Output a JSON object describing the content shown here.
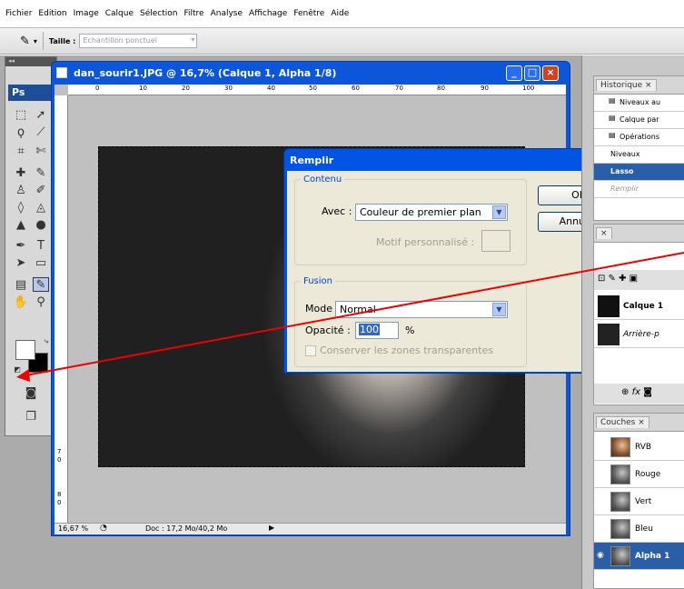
{
  "menu": [
    "Fichier",
    "Edition",
    "Image",
    "Calque",
    "Sélection",
    "Filtre",
    "Analyse",
    "Affichage",
    "Fenêtre",
    "Aide"
  ],
  "options": {
    "size_label": "Taille :",
    "size_value": "Echantillon ponctuel"
  },
  "toolbox": {
    "logo": "Ps"
  },
  "document": {
    "title": "dan_sourir1.JPG @ 16,7% (Calque 1, Alpha 1/8)",
    "zoom": "16,67 %",
    "doc_info": "Doc : 17,2 Mo/40,2 Mo",
    "ruler_h": [
      "0",
      "10",
      "20",
      "30",
      "40",
      "50",
      "60",
      "70",
      "80",
      "90",
      "100"
    ],
    "ruler_v": [
      "7",
      "0",
      "8",
      "0",
      "9",
      "0"
    ]
  },
  "dialog": {
    "title": "Remplir",
    "contenu_legend": "Contenu",
    "avec_label": "Avec :",
    "avec_value": "Couleur de premier plan",
    "motif_label": "Motif personnalisé :",
    "ok": "OK",
    "annuler": "Annuler",
    "fusion_legend": "Fusion",
    "mode_label": "Mode :",
    "mode_value": "Normal",
    "opacite_label": "Opacité :",
    "opacite_value": "100",
    "opacite_unit": "%",
    "conserver_label": "Conserver les zones transparentes"
  },
  "history": {
    "tab": "Historique",
    "items": [
      "Niveaux au",
      "Calque par",
      "Opérations",
      "Niveaux",
      "Lasso",
      "Remplir"
    ]
  },
  "layers": {
    "items": [
      "Calque 1",
      "Arrière-p"
    ]
  },
  "channels": {
    "tab": "Couches",
    "items": [
      "RVB",
      "Rouge",
      "Vert",
      "Bleu",
      "Alpha 1"
    ]
  }
}
